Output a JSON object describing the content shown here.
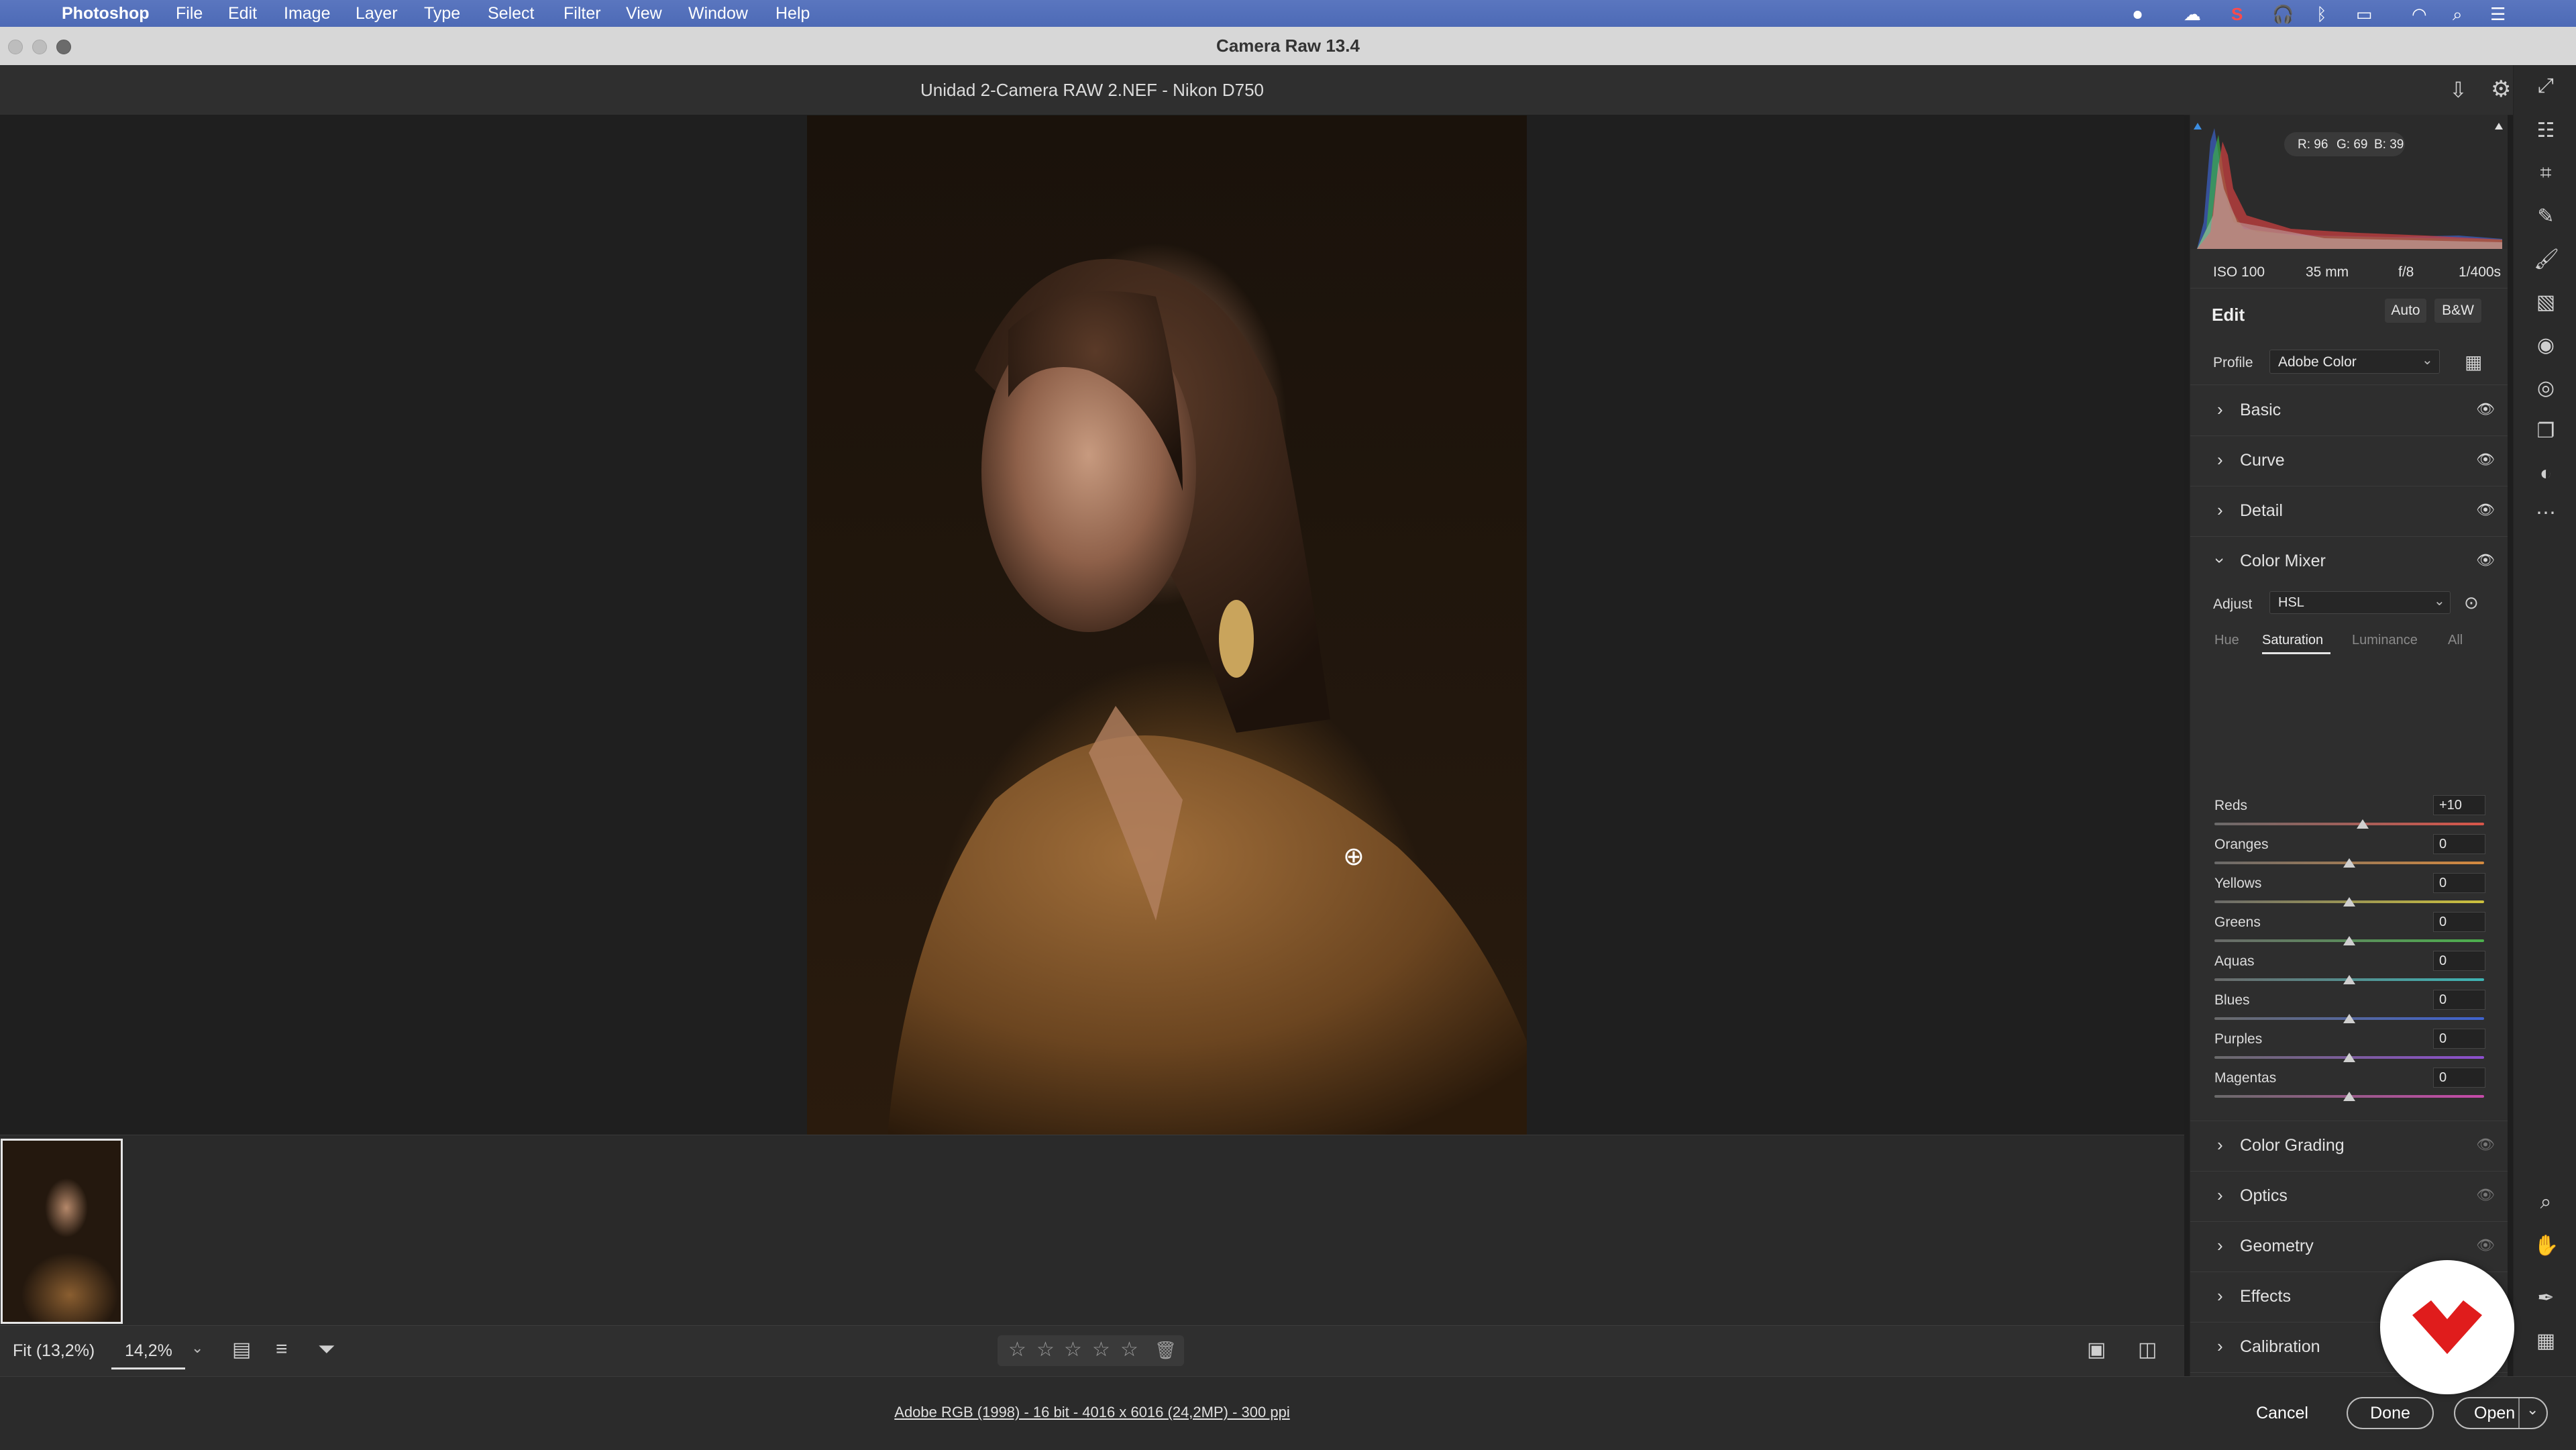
{
  "menubar": {
    "app": "Photoshop",
    "items": [
      "File",
      "Edit",
      "Image",
      "Layer",
      "Type",
      "Select",
      "Filter",
      "View",
      "Window",
      "Help"
    ],
    "status_icons": [
      "record-icon",
      "creative-cloud-icon",
      "s-icon",
      "headphones-icon",
      "bluetooth-icon",
      "battery-icon",
      "wifi-icon",
      "spotlight-search-icon",
      "control-center-icon"
    ]
  },
  "window": {
    "title": "Camera Raw 13.4"
  },
  "header": {
    "filename": "Unidad 2-Camera RAW 2.NEF  -  Nikon D750"
  },
  "histogram": {
    "r": "R: 96",
    "g": "G: 69",
    "b": "B: 39"
  },
  "meta": {
    "iso": "ISO 100",
    "focal": "35 mm",
    "aperture": "f/8",
    "shutter": "1/400s"
  },
  "edit": {
    "title": "Edit",
    "auto": "Auto",
    "bw": "B&W",
    "profile_label": "Profile",
    "profile_value": "Adobe Color"
  },
  "sections_top": [
    {
      "label": "Basic"
    },
    {
      "label": "Curve"
    },
    {
      "label": "Detail"
    }
  ],
  "color_mixer": {
    "label": "Color Mixer",
    "adjust_label": "Adjust",
    "adjust_value": "HSL",
    "tabs": [
      "Hue",
      "Saturation",
      "Luminance",
      "All"
    ],
    "active_tab": "Saturation",
    "sliders": [
      {
        "name": "Reds",
        "value": "+10",
        "position": 0.55,
        "color": "#d9564a"
      },
      {
        "name": "Oranges",
        "value": "0",
        "position": 0.5,
        "color": "#d58a3f"
      },
      {
        "name": "Yellows",
        "value": "0",
        "position": 0.5,
        "color": "#cdc13d"
      },
      {
        "name": "Greens",
        "value": "0",
        "position": 0.5,
        "color": "#4cb04d"
      },
      {
        "name": "Aquas",
        "value": "0",
        "position": 0.5,
        "color": "#3eb5b5"
      },
      {
        "name": "Blues",
        "value": "0",
        "position": 0.5,
        "color": "#3f63d0"
      },
      {
        "name": "Purples",
        "value": "0",
        "position": 0.5,
        "color": "#8d4fcf"
      },
      {
        "name": "Magentas",
        "value": "0",
        "position": 0.5,
        "color": "#c64aa9"
      }
    ]
  },
  "sections_bottom": [
    {
      "label": "Color Grading"
    },
    {
      "label": "Optics"
    },
    {
      "label": "Geometry"
    },
    {
      "label": "Effects"
    },
    {
      "label": "Calibration"
    }
  ],
  "toolbar": {
    "fit": "Fit (13,2%)",
    "zoom": "14,2%"
  },
  "footer": {
    "info": "Adobe RGB (1998) - 16 bit - 4016 x 6016 (24,2MP) - 300 ppi",
    "cancel": "Cancel",
    "done": "Done",
    "open": "Open"
  }
}
